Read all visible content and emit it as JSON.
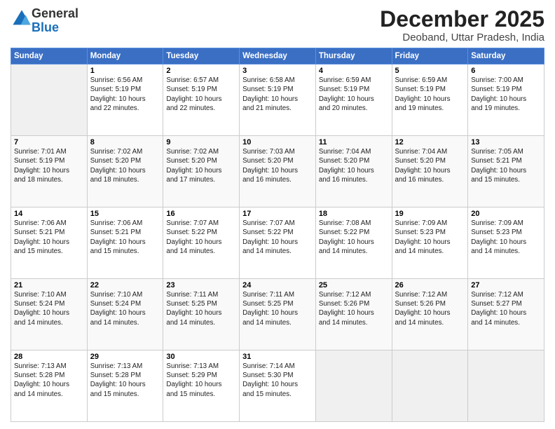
{
  "logo": {
    "general": "General",
    "blue": "Blue"
  },
  "title": "December 2025",
  "location": "Deoband, Uttar Pradesh, India",
  "days_header": [
    "Sunday",
    "Monday",
    "Tuesday",
    "Wednesday",
    "Thursday",
    "Friday",
    "Saturday"
  ],
  "weeks": [
    [
      {
        "num": "",
        "info": ""
      },
      {
        "num": "1",
        "info": "Sunrise: 6:56 AM\nSunset: 5:19 PM\nDaylight: 10 hours\nand 22 minutes."
      },
      {
        "num": "2",
        "info": "Sunrise: 6:57 AM\nSunset: 5:19 PM\nDaylight: 10 hours\nand 22 minutes."
      },
      {
        "num": "3",
        "info": "Sunrise: 6:58 AM\nSunset: 5:19 PM\nDaylight: 10 hours\nand 21 minutes."
      },
      {
        "num": "4",
        "info": "Sunrise: 6:59 AM\nSunset: 5:19 PM\nDaylight: 10 hours\nand 20 minutes."
      },
      {
        "num": "5",
        "info": "Sunrise: 6:59 AM\nSunset: 5:19 PM\nDaylight: 10 hours\nand 19 minutes."
      },
      {
        "num": "6",
        "info": "Sunrise: 7:00 AM\nSunset: 5:19 PM\nDaylight: 10 hours\nand 19 minutes."
      }
    ],
    [
      {
        "num": "7",
        "info": "Sunrise: 7:01 AM\nSunset: 5:19 PM\nDaylight: 10 hours\nand 18 minutes."
      },
      {
        "num": "8",
        "info": "Sunrise: 7:02 AM\nSunset: 5:20 PM\nDaylight: 10 hours\nand 18 minutes."
      },
      {
        "num": "9",
        "info": "Sunrise: 7:02 AM\nSunset: 5:20 PM\nDaylight: 10 hours\nand 17 minutes."
      },
      {
        "num": "10",
        "info": "Sunrise: 7:03 AM\nSunset: 5:20 PM\nDaylight: 10 hours\nand 16 minutes."
      },
      {
        "num": "11",
        "info": "Sunrise: 7:04 AM\nSunset: 5:20 PM\nDaylight: 10 hours\nand 16 minutes."
      },
      {
        "num": "12",
        "info": "Sunrise: 7:04 AM\nSunset: 5:20 PM\nDaylight: 10 hours\nand 16 minutes."
      },
      {
        "num": "13",
        "info": "Sunrise: 7:05 AM\nSunset: 5:21 PM\nDaylight: 10 hours\nand 15 minutes."
      }
    ],
    [
      {
        "num": "14",
        "info": "Sunrise: 7:06 AM\nSunset: 5:21 PM\nDaylight: 10 hours\nand 15 minutes."
      },
      {
        "num": "15",
        "info": "Sunrise: 7:06 AM\nSunset: 5:21 PM\nDaylight: 10 hours\nand 15 minutes."
      },
      {
        "num": "16",
        "info": "Sunrise: 7:07 AM\nSunset: 5:22 PM\nDaylight: 10 hours\nand 14 minutes."
      },
      {
        "num": "17",
        "info": "Sunrise: 7:07 AM\nSunset: 5:22 PM\nDaylight: 10 hours\nand 14 minutes."
      },
      {
        "num": "18",
        "info": "Sunrise: 7:08 AM\nSunset: 5:22 PM\nDaylight: 10 hours\nand 14 minutes."
      },
      {
        "num": "19",
        "info": "Sunrise: 7:09 AM\nSunset: 5:23 PM\nDaylight: 10 hours\nand 14 minutes."
      },
      {
        "num": "20",
        "info": "Sunrise: 7:09 AM\nSunset: 5:23 PM\nDaylight: 10 hours\nand 14 minutes."
      }
    ],
    [
      {
        "num": "21",
        "info": "Sunrise: 7:10 AM\nSunset: 5:24 PM\nDaylight: 10 hours\nand 14 minutes."
      },
      {
        "num": "22",
        "info": "Sunrise: 7:10 AM\nSunset: 5:24 PM\nDaylight: 10 hours\nand 14 minutes."
      },
      {
        "num": "23",
        "info": "Sunrise: 7:11 AM\nSunset: 5:25 PM\nDaylight: 10 hours\nand 14 minutes."
      },
      {
        "num": "24",
        "info": "Sunrise: 7:11 AM\nSunset: 5:25 PM\nDaylight: 10 hours\nand 14 minutes."
      },
      {
        "num": "25",
        "info": "Sunrise: 7:12 AM\nSunset: 5:26 PM\nDaylight: 10 hours\nand 14 minutes."
      },
      {
        "num": "26",
        "info": "Sunrise: 7:12 AM\nSunset: 5:26 PM\nDaylight: 10 hours\nand 14 minutes."
      },
      {
        "num": "27",
        "info": "Sunrise: 7:12 AM\nSunset: 5:27 PM\nDaylight: 10 hours\nand 14 minutes."
      }
    ],
    [
      {
        "num": "28",
        "info": "Sunrise: 7:13 AM\nSunset: 5:28 PM\nDaylight: 10 hours\nand 14 minutes."
      },
      {
        "num": "29",
        "info": "Sunrise: 7:13 AM\nSunset: 5:28 PM\nDaylight: 10 hours\nand 15 minutes."
      },
      {
        "num": "30",
        "info": "Sunrise: 7:13 AM\nSunset: 5:29 PM\nDaylight: 10 hours\nand 15 minutes."
      },
      {
        "num": "31",
        "info": "Sunrise: 7:14 AM\nSunset: 5:30 PM\nDaylight: 10 hours\nand 15 minutes."
      },
      {
        "num": "",
        "info": ""
      },
      {
        "num": "",
        "info": ""
      },
      {
        "num": "",
        "info": ""
      }
    ]
  ]
}
